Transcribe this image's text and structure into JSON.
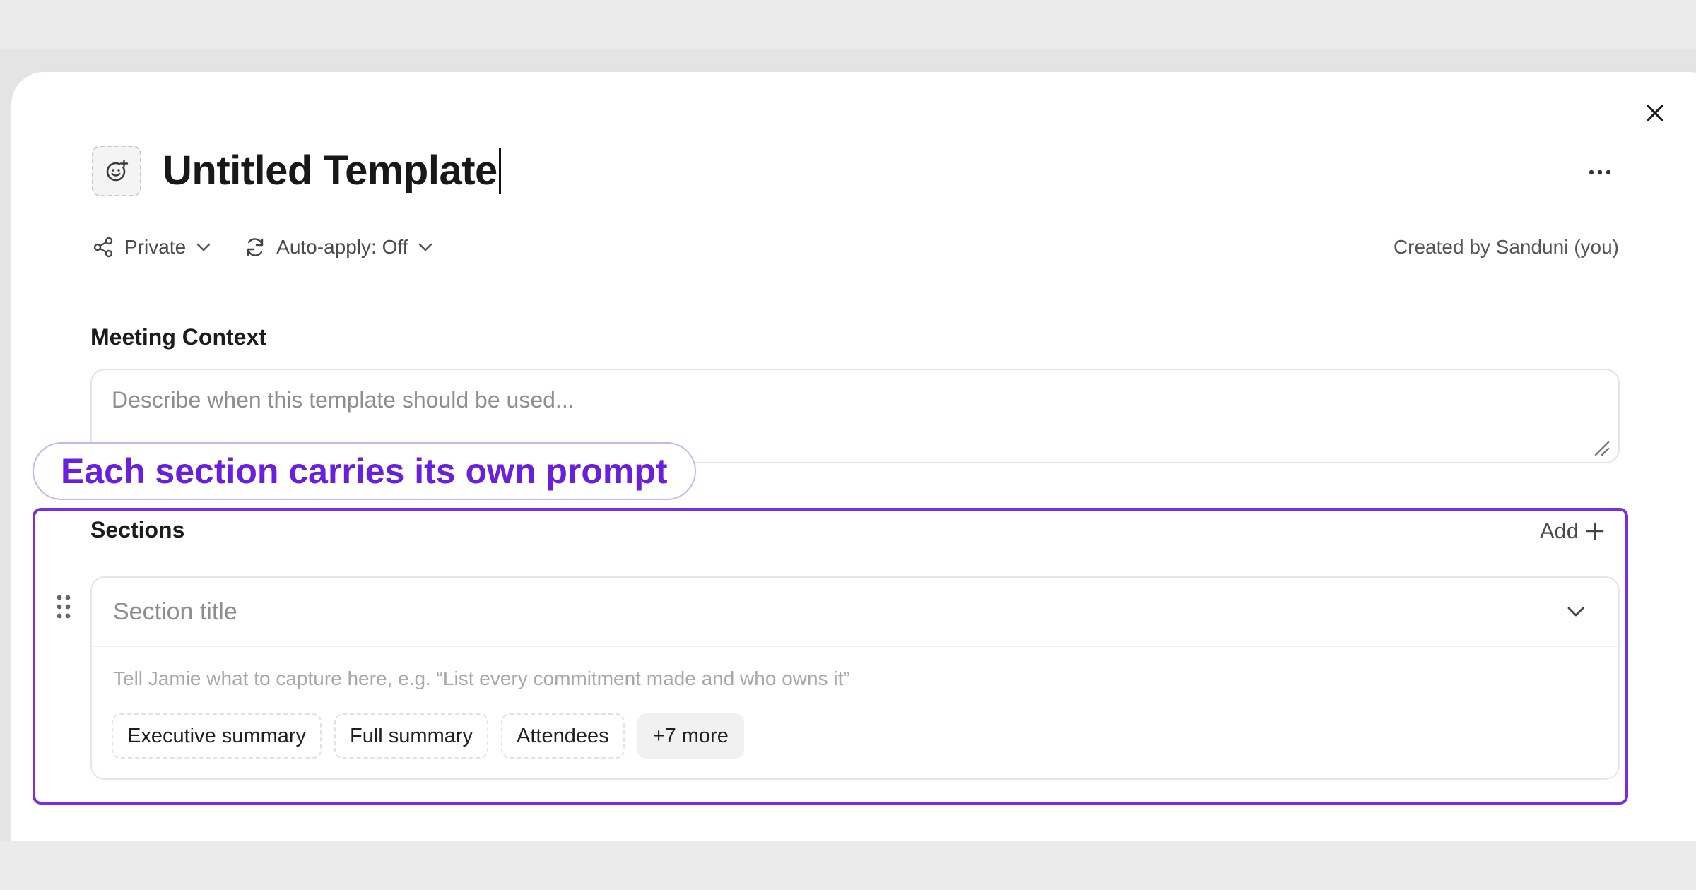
{
  "header": {
    "title": "Untitled Template",
    "emoji_icon": "smiley-add-icon",
    "close_icon": "close-icon",
    "more_icon": "ellipsis-icon"
  },
  "meta": {
    "visibility_label": "Private",
    "auto_apply_label": "Auto-apply: Off",
    "created_by": "Created by Sanduni (you)"
  },
  "meeting_context": {
    "heading": "Meeting Context",
    "placeholder": "Describe when this template should be used..."
  },
  "annotation": {
    "text": "Each section carries its own prompt",
    "color": "#6a1fe0"
  },
  "sections": {
    "heading": "Sections",
    "add_label": "Add",
    "items": [
      {
        "title_placeholder": "Section title",
        "prompt_placeholder": "Tell Jamie what to capture here, e.g. “List every commitment made and who owns it”",
        "chips": [
          "Executive summary",
          "Full summary",
          "Attendees"
        ],
        "more_chip": "+7 more"
      }
    ]
  },
  "colors": {
    "accent": "#7a2ce0",
    "annotation_text": "#6a1fe0"
  }
}
